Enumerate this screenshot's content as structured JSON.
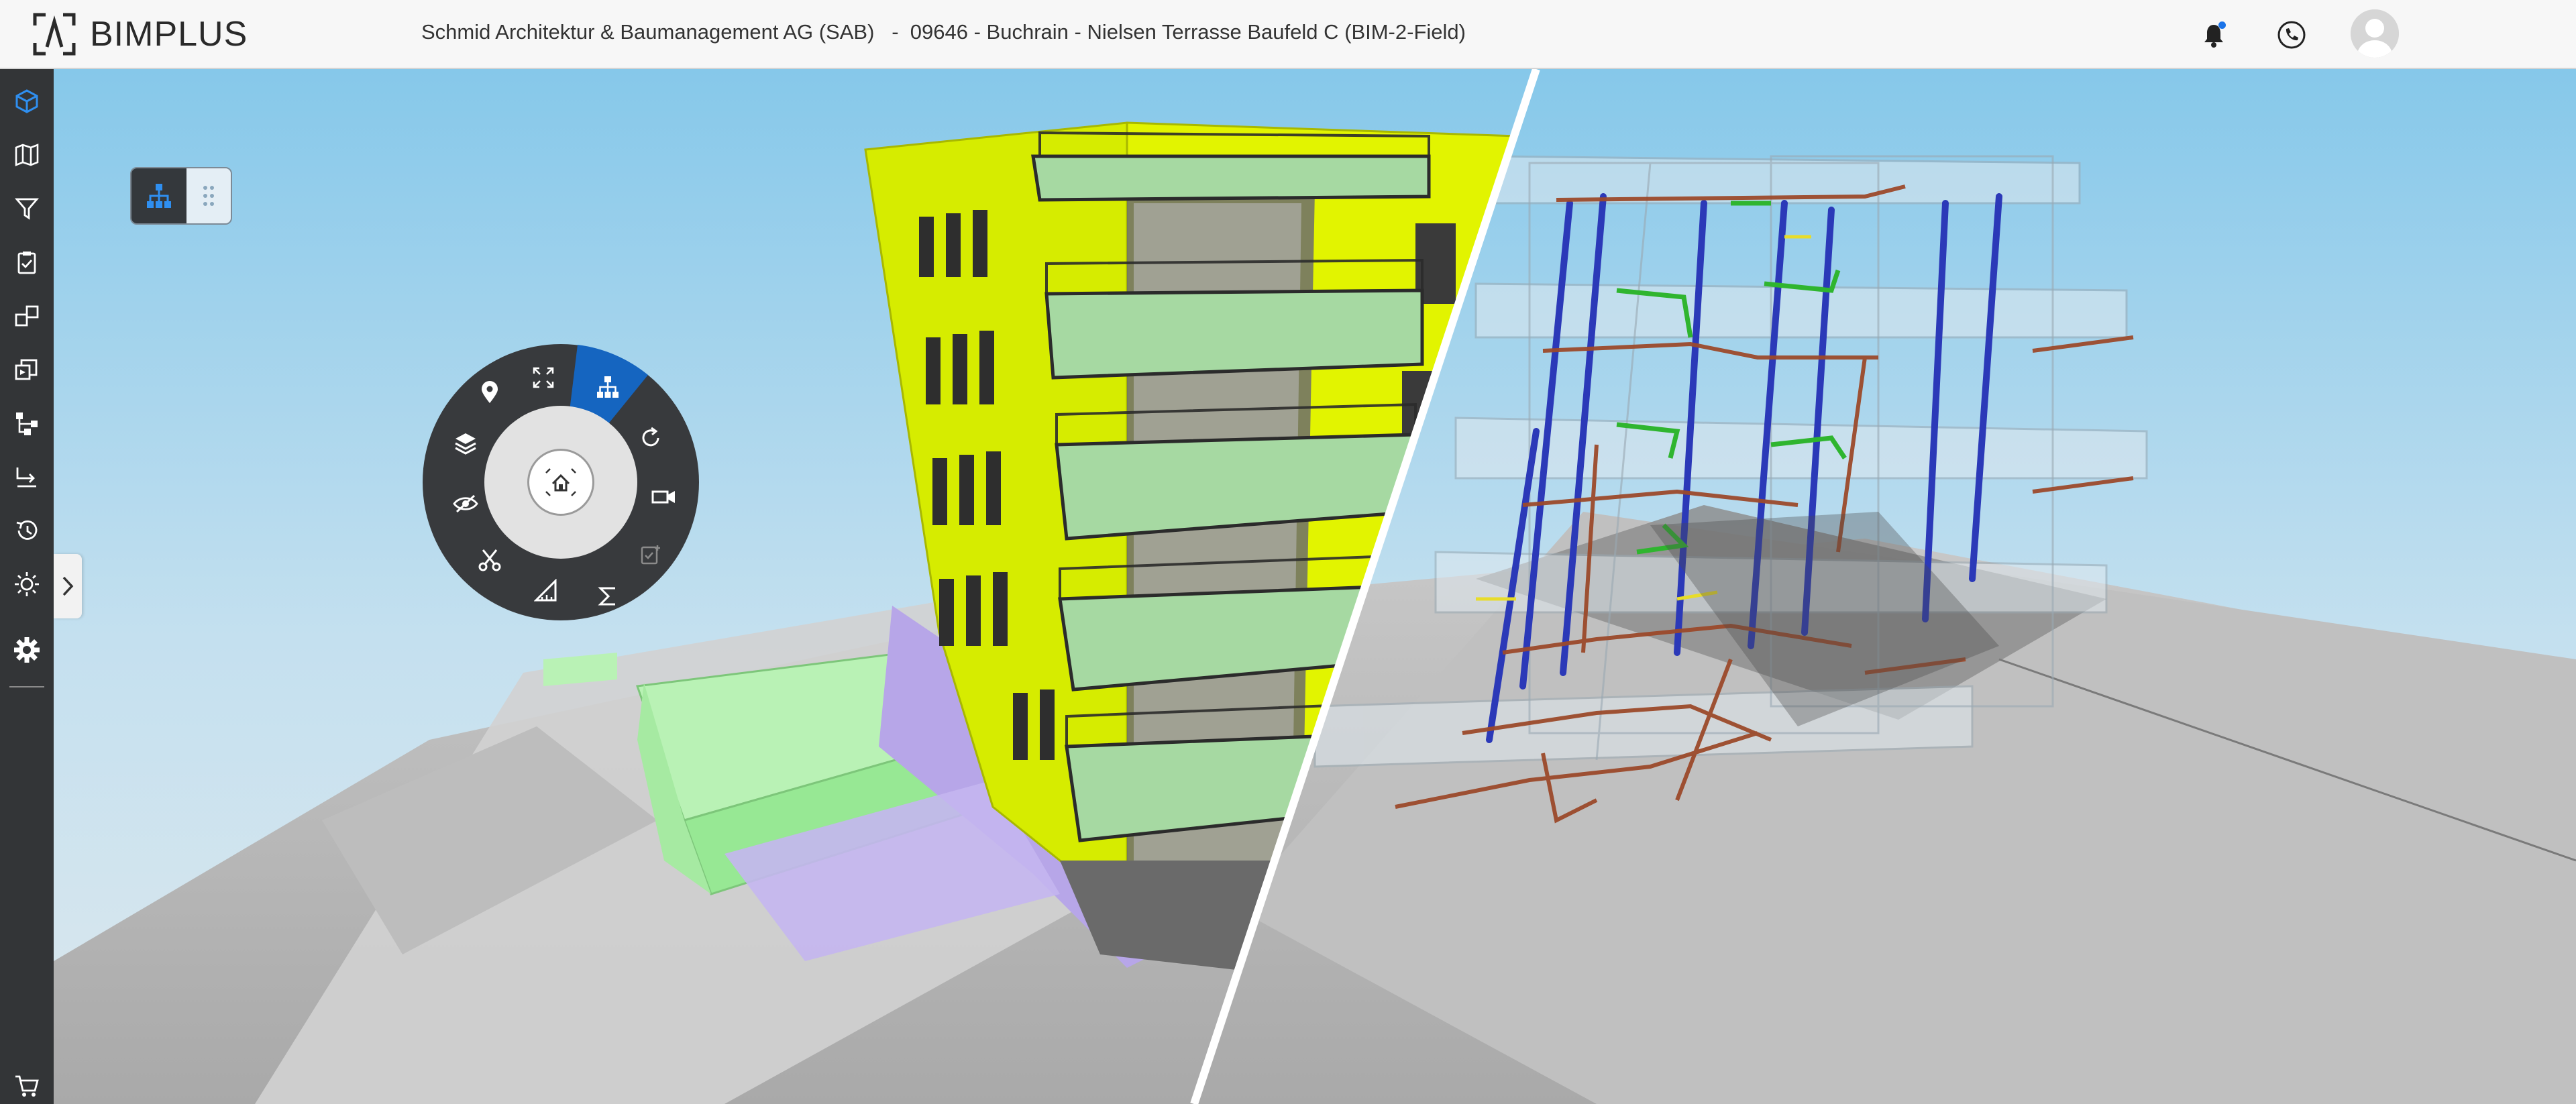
{
  "app": {
    "brand": "BIMPLUS",
    "project_title": "Schmid Architektur & Baumanagement AG (SAB)   -  09646 - Buchrain - Nielsen Terrasse Baufeld C (BIM-2-Field)"
  },
  "header": {
    "icons": [
      "bell-icon",
      "phone-icon",
      "user-avatar-icon"
    ],
    "notification_badge": true
  },
  "sidebar": {
    "items": [
      {
        "name": "3d-model-icon",
        "active": true
      },
      {
        "name": "map-icon"
      },
      {
        "name": "filter-icon"
      },
      {
        "name": "clipboard-check-icon"
      },
      {
        "name": "compare-icon"
      },
      {
        "name": "slides-icon"
      },
      {
        "name": "hierarchy-tree-icon"
      },
      {
        "name": "indent-list-icon"
      },
      {
        "name": "history-icon"
      },
      {
        "name": "brightness-icon"
      },
      {
        "name": "settings-icon"
      },
      {
        "name": "cart-icon"
      }
    ]
  },
  "viewport": {
    "toolbox": [
      "structure-tree-icon",
      "drag-handle-icon"
    ],
    "radial_menu": {
      "center": "home-view-icon",
      "items": [
        "fit-view-icon",
        "structure-icon",
        "rotate-icon",
        "camera-icon",
        "add-task-icon",
        "sum-icon",
        "measure-icon",
        "clip-icon",
        "hide-icon",
        "layers-icon",
        "location-pin-icon"
      ],
      "active": "structure-icon"
    }
  },
  "colors": {
    "accent": "#1565c0",
    "sidebar_bg": "#333537",
    "facade_yellow": "#d8ef00",
    "sky_top": "#86c8ea",
    "ground": "#b9b9b9",
    "pipe_blue": "#2b39b8",
    "pipe_brown": "#9c4a2b",
    "pipe_green": "#2fb52f"
  }
}
